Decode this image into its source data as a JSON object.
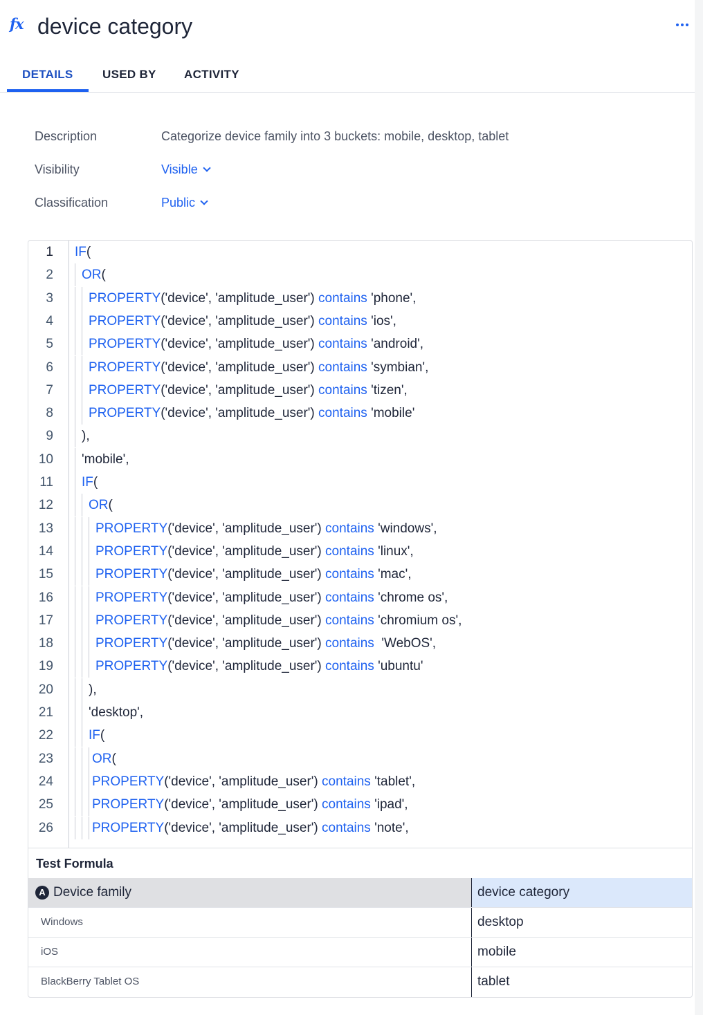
{
  "header": {
    "icon": "fx-icon",
    "title": "device category"
  },
  "tabs": [
    {
      "label": "DETAILS",
      "active": true
    },
    {
      "label": "USED BY",
      "active": false
    },
    {
      "label": "ACTIVITY",
      "active": false
    }
  ],
  "details": {
    "description_label": "Description",
    "description_value": "Categorize device family into 3 buckets: mobile, desktop, tablet",
    "visibility_label": "Visibility",
    "visibility_value": "Visible",
    "classification_label": "Classification",
    "classification_value": "Public"
  },
  "code": {
    "lines": [
      {
        "n": "1",
        "indent": 0,
        "kw": "IF",
        "rest": "("
      },
      {
        "n": "2",
        "indent": 1,
        "kw": "OR",
        "rest": "("
      },
      {
        "n": "3",
        "indent": 2,
        "kw": "PROPERTY",
        "rest": "('device', 'amplitude_user') ",
        "kw2": "contains",
        "tail": " 'phone',"
      },
      {
        "n": "4",
        "indent": 2,
        "kw": "PROPERTY",
        "rest": "('device', 'amplitude_user') ",
        "kw2": "contains",
        "tail": " 'ios',"
      },
      {
        "n": "5",
        "indent": 2,
        "kw": "PROPERTY",
        "rest": "('device', 'amplitude_user') ",
        "kw2": "contains",
        "tail": " 'android',"
      },
      {
        "n": "6",
        "indent": 2,
        "kw": "PROPERTY",
        "rest": "('device', 'amplitude_user') ",
        "kw2": "contains",
        "tail": " 'symbian',"
      },
      {
        "n": "7",
        "indent": 2,
        "kw": "PROPERTY",
        "rest": "('device', 'amplitude_user') ",
        "kw2": "contains",
        "tail": " 'tizen',"
      },
      {
        "n": "8",
        "indent": 2,
        "kw": "PROPERTY",
        "rest": "('device', 'amplitude_user') ",
        "kw2": "contains",
        "tail": " 'mobile'"
      },
      {
        "n": "9",
        "indent": 1,
        "kw": "",
        "rest": "),"
      },
      {
        "n": "10",
        "indent": 1,
        "kw": "",
        "rest": "'mobile',"
      },
      {
        "n": "11",
        "indent": 1,
        "kw": "IF",
        "rest": "("
      },
      {
        "n": "12",
        "indent": 2,
        "kw": "OR",
        "rest": "("
      },
      {
        "n": "13",
        "indent": 3,
        "kw": "PROPERTY",
        "rest": "('device', 'amplitude_user') ",
        "kw2": "contains",
        "tail": " 'windows',"
      },
      {
        "n": "14",
        "indent": 3,
        "kw": "PROPERTY",
        "rest": "('device', 'amplitude_user') ",
        "kw2": "contains",
        "tail": " 'linux',"
      },
      {
        "n": "15",
        "indent": 3,
        "kw": "PROPERTY",
        "rest": "('device', 'amplitude_user') ",
        "kw2": "contains",
        "tail": " 'mac',"
      },
      {
        "n": "16",
        "indent": 3,
        "kw": "PROPERTY",
        "rest": "('device', 'amplitude_user') ",
        "kw2": "contains",
        "tail": " 'chrome os',"
      },
      {
        "n": "17",
        "indent": 3,
        "kw": "PROPERTY",
        "rest": "('device', 'amplitude_user') ",
        "kw2": "contains",
        "tail": " 'chromium os',"
      },
      {
        "n": "18",
        "indent": 3,
        "kw": "PROPERTY",
        "rest": "('device', 'amplitude_user') ",
        "kw2": "contains",
        "tail": "  'WebOS',"
      },
      {
        "n": "19",
        "indent": 3,
        "kw": "PROPERTY",
        "rest": "('device', 'amplitude_user') ",
        "kw2": "contains",
        "tail": " 'ubuntu'"
      },
      {
        "n": "20",
        "indent": 2,
        "kw": "",
        "rest": "),"
      },
      {
        "n": "21",
        "indent": 2,
        "kw": "",
        "rest": "'desktop',"
      },
      {
        "n": "22",
        "indent": 2,
        "kw": "IF",
        "rest": "("
      },
      {
        "n": "23",
        "indent": 2.5,
        "kw": "OR",
        "rest": "("
      },
      {
        "n": "24",
        "indent": 2.5,
        "kw": "PROPERTY",
        "rest": "('device', 'amplitude_user') ",
        "kw2": "contains",
        "tail": " 'tablet',"
      },
      {
        "n": "25",
        "indent": 2.5,
        "kw": "PROPERTY",
        "rest": "('device', 'amplitude_user') ",
        "kw2": "contains",
        "tail": " 'ipad',"
      },
      {
        "n": "26",
        "indent": 2.5,
        "kw": "PROPERTY",
        "rest": "('device', 'amplitude_user') ",
        "kw2": "contains",
        "tail": " 'note',"
      }
    ]
  },
  "test": {
    "title": "Test Formula",
    "col_left": "Device family",
    "col_right": "device category",
    "rows": [
      {
        "input": "Windows",
        "output": "desktop"
      },
      {
        "input": "iOS",
        "output": "mobile"
      },
      {
        "input": "BlackBerry Tablet OS",
        "output": "tablet"
      }
    ]
  },
  "colors": {
    "accent": "#1e61f0",
    "text": "#1e2538",
    "muted": "#4c5363"
  }
}
